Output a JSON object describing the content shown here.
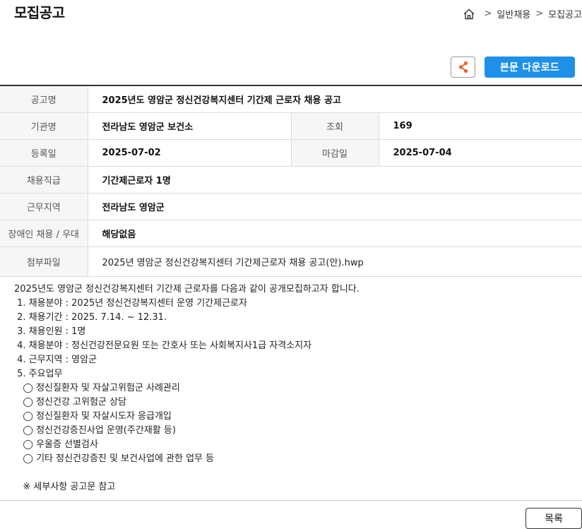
{
  "page_title": "모집공고",
  "breadcrumb": {
    "items": [
      "일반채용",
      "모집공고"
    ],
    "separator": ">"
  },
  "actions": {
    "share_icon": "share-icon",
    "download_label": "본문 다운로드",
    "list_label": "목록"
  },
  "colors": {
    "accent": "#1e90e8",
    "share": "#e8642c"
  },
  "info": {
    "title_label": "공고명",
    "title_value": "2025년도 영암군 정신건강복지센터 기간제 근로자 채용 공고",
    "org_label": "기관명",
    "org_value": "전라남도 영암군 보건소",
    "views_label": "조회",
    "views_value": "169",
    "reg_label": "등록일",
    "reg_value": "2025-07-02",
    "deadline_label": "마감일",
    "deadline_value": "2025-07-04",
    "rank_label": "채용직급",
    "rank_value": "기간제근로자 1명",
    "region_label": "근무지역",
    "region_value": "전라남도 영암군",
    "disabled_label": "장애인 채용 / 우대",
    "disabled_value": "해당없음",
    "file_label": "첨부파일",
    "file_value": "2025년 영암군 정신건강복지센터 기간제근로자 채용 공고(안).hwp"
  },
  "body_lines": [
    "2025년도 영암군 정신건강복지센터 기간제 근로자를 다음과 같이 공개모집하고자 합니다.",
    " 1. 채용분야 : 2025년 정신건강복지센터 운영 기간제근로자",
    " 2. 채용기간 : 2025. 7.14. ~ 12.31.",
    " 3. 채용인원 : 1명",
    " 4. 채용분야 : 정신건강전문요원 또는 간호사 또는 사회복지사1급 자격소지자",
    " 4. 근무지역 : 영암군",
    " 5. 주요업무",
    "   ◯ 정신질환자 및 자살고위험군 사례관리",
    "   ◯ 정신건강 고위험군 상담",
    "   ◯ 정신질환자 및 자살시도자 응급개입",
    "   ◯ 정신건강증진사업 운영(주간재활 등)",
    "   ◯ 우울증 선별검사",
    "   ◯ 기타 정신건강증진 및 보건사업에 관한 업무 등",
    "",
    "   ※ 세부사항 공고문 참고"
  ]
}
